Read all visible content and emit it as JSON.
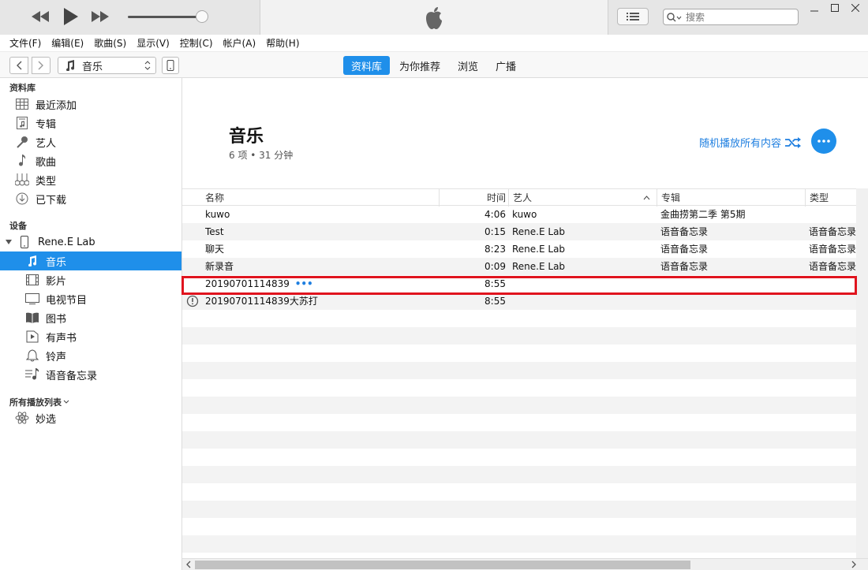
{
  "menu": [
    "文件(F)",
    "编辑(E)",
    "歌曲(S)",
    "显示(V)",
    "控制(C)",
    "帐户(A)",
    "帮助(H)"
  ],
  "search": {
    "placeholder": "搜索"
  },
  "nav": {
    "source_label": "音乐"
  },
  "tabs": [
    {
      "label": "资料库",
      "active": true
    },
    {
      "label": "为你推荐",
      "active": false
    },
    {
      "label": "浏览",
      "active": false
    },
    {
      "label": "广播",
      "active": false
    }
  ],
  "sidebar": {
    "library_title": "资料库",
    "library": [
      {
        "label": "最近添加",
        "icon": "grid-icon"
      },
      {
        "label": "专辑",
        "icon": "album-icon"
      },
      {
        "label": "艺人",
        "icon": "microphone-icon"
      },
      {
        "label": "歌曲",
        "icon": "music-note-icon"
      },
      {
        "label": "类型",
        "icon": "guitar-icon"
      },
      {
        "label": "已下载",
        "icon": "download-icon"
      }
    ],
    "devices_title": "设备",
    "device_name": "Rene.E Lab",
    "device_items": [
      {
        "label": "音乐",
        "icon": "music-note-icon",
        "selected": true
      },
      {
        "label": "影片",
        "icon": "film-icon"
      },
      {
        "label": "电视节目",
        "icon": "tv-icon"
      },
      {
        "label": "图书",
        "icon": "book-icon"
      },
      {
        "label": "有声书",
        "icon": "audiobook-icon"
      },
      {
        "label": "铃声",
        "icon": "bell-icon"
      },
      {
        "label": "语音备忘录",
        "icon": "voice-memo-icon"
      }
    ],
    "playlists_title": "所有播放列表",
    "playlists": [
      {
        "label": "妙选",
        "icon": "atom-icon"
      }
    ]
  },
  "main": {
    "title": "音乐",
    "subtitle": "6 项 • 31 分钟",
    "shuffle_label": "随机播放所有内容",
    "columns": {
      "name": "名称",
      "time": "时间",
      "artist": "艺人",
      "album": "专辑",
      "genre": "类型"
    },
    "rows": [
      {
        "name": "kuwo",
        "time": "4:06",
        "artist": "kuwo",
        "album": "金曲捞第二季 第5期",
        "genre": ""
      },
      {
        "name": "Test",
        "time": "0:15",
        "artist": "Rene.E Lab",
        "album": "语音备忘录",
        "genre": "语音备忘录"
      },
      {
        "name": "聊天",
        "time": "8:23",
        "artist": "Rene.E Lab",
        "album": "语音备忘录",
        "genre": "语音备忘录"
      },
      {
        "name": "新录音",
        "time": "0:09",
        "artist": "Rene.E Lab",
        "album": "语音备忘录",
        "genre": "语音备忘录"
      },
      {
        "name": "20190701114839",
        "time": "8:55",
        "artist": "",
        "album": "",
        "genre": "",
        "more": "•••"
      },
      {
        "name": "20190701114839大苏打",
        "time": "8:55",
        "artist": "",
        "album": "",
        "genre": "",
        "warning": true
      }
    ]
  }
}
